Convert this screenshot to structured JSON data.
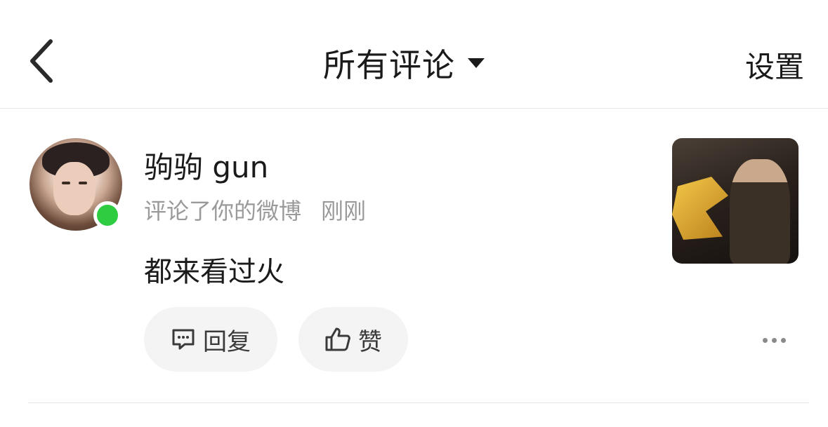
{
  "header": {
    "title": "所有评论",
    "settings_label": "设置"
  },
  "notification": {
    "username": "驹驹 gun",
    "action": "评论了你的微博",
    "time": "刚刚",
    "comment": "都来看过火",
    "reply_label": "回复",
    "like_label": "赞",
    "online_color": "#2ecc40"
  },
  "icons": {
    "back": "chevron-left-icon",
    "dropdown": "caret-down-icon",
    "reply": "comment-bubble-icon",
    "like": "thumbs-up-icon",
    "more": "more-horizontal-icon"
  }
}
